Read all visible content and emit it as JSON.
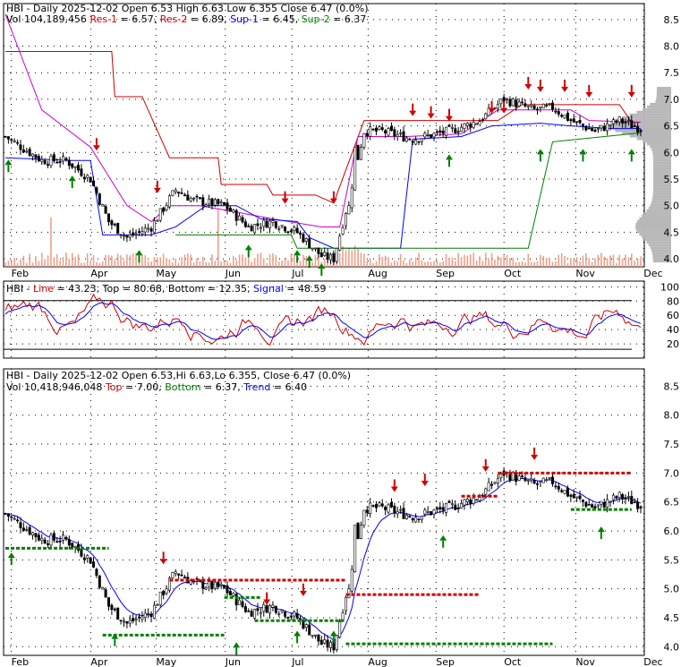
{
  "panels": {
    "top": {
      "info_line1_parts": [
        {
          "text": "HBI - Daily 2025-12-02 Open 6.53  High 6.63  Low 6.355  Close 6.47 (0.0%)",
          "color": "#000000"
        }
      ],
      "info_line2_parts": [
        {
          "text": "Vol 104,189,456 ",
          "color": "#000000"
        },
        {
          "text": "Res-1",
          "color": "#d00000"
        },
        {
          "text": " = 6.57, ",
          "color": "#000000"
        },
        {
          "text": "Res-2",
          "color": "#d00000"
        },
        {
          "text": " = 6.89, ",
          "color": "#000000"
        },
        {
          "text": "Sup-1",
          "color": "#0000ff"
        },
        {
          "text": " = 6.45, ",
          "color": "#000000"
        },
        {
          "text": "Sup-2",
          "color": "#008000"
        },
        {
          "text": " = 6.37",
          "color": "#000000"
        }
      ],
      "y_ticks": [
        "8.5",
        "8.0",
        "7.5",
        "7.0",
        "6.5",
        "6.0",
        "5.5",
        "5.0",
        "4.5",
        "4.0"
      ],
      "y_tick_values": [
        8.5,
        8.0,
        7.5,
        7.0,
        6.5,
        6.0,
        5.5,
        5.0,
        4.5,
        4.0
      ]
    },
    "middle": {
      "info_parts": [
        {
          "text": "HBI - ",
          "color": "#000000"
        },
        {
          "text": "Line",
          "color": "#d00000"
        },
        {
          "text": " = 43.23, Top = 80.68, Bottom = 12.35, ",
          "color": "#000000"
        },
        {
          "text": "Signal",
          "color": "#0000ff"
        },
        {
          "text": " = 48.59",
          "color": "#000000"
        }
      ],
      "y_ticks": [
        "100",
        "80",
        "60",
        "40",
        "20"
      ],
      "y_tick_values": [
        100,
        80,
        60,
        40,
        20
      ]
    },
    "bottom": {
      "info_line1_parts": [
        {
          "text": "HBI - Daily 2025-12-02 Open 6.53,Hi 6.63,Lo 6.355, Close 6.47 (0.0%)",
          "color": "#000000"
        }
      ],
      "info_line2_parts": [
        {
          "text": "Vol 10,418,946,048 ",
          "color": "#000000"
        },
        {
          "text": "Top",
          "color": "#d00000"
        },
        {
          "text": " = 7.00, ",
          "color": "#000000"
        },
        {
          "text": "Bottom",
          "color": "#008000"
        },
        {
          "text": " = 6.37, ",
          "color": "#000000"
        },
        {
          "text": "Trend",
          "color": "#0000ff"
        },
        {
          "text": " = 6.40",
          "color": "#000000"
        }
      ],
      "y_ticks": [
        "8.5",
        "8.0",
        "7.5",
        "7.0",
        "6.5",
        "6.0",
        "5.5",
        "5.0",
        "4.5",
        "4.0"
      ],
      "y_tick_values": [
        8.5,
        8.0,
        7.5,
        7.0,
        6.5,
        6.0,
        5.5,
        5.0,
        4.5,
        4.0
      ]
    }
  },
  "x_month_labels": [
    "Feb",
    "Apr",
    "May",
    "Jun",
    "Jul",
    "Aug",
    "Sep",
    "Oct",
    "Nov",
    "Dec"
  ],
  "x_month_positions": [
    0.012,
    0.136,
    0.238,
    0.346,
    0.45,
    0.569,
    0.675,
    0.781,
    0.893,
    0.999
  ],
  "colors": {
    "up": "#008000",
    "down": "#d00000",
    "resistance": "#d00000",
    "support": "#008000",
    "trend": "#0000ff",
    "magenta": "#cc00cc",
    "volume": "#f0a08a",
    "profile": "#b8b8b8"
  },
  "chart_data": [
    {
      "type": "candlestick",
      "title": "HBI - Daily 2025-12-02 Open 6.53  High 6.63  Low 6.355  Close 6.47 (0.0%)",
      "ylim": [
        3.85,
        8.8
      ],
      "x": [
        "2025-02",
        "2025-03",
        "2025-04",
        "2025-05",
        "2025-06",
        "2025-07",
        "2025-08",
        "2025-09",
        "2025-10",
        "2025-11",
        "2025-12"
      ],
      "key_points": [
        [
          0,
          6.3
        ],
        [
          12,
          5.85
        ],
        [
          20,
          5.85
        ],
        [
          28,
          5.5
        ],
        [
          34,
          4.7
        ],
        [
          40,
          4.4
        ],
        [
          48,
          4.6
        ],
        [
          56,
          5.3
        ],
        [
          62,
          5.1
        ],
        [
          72,
          5.0
        ],
        [
          80,
          4.6
        ],
        [
          88,
          4.7
        ],
        [
          96,
          4.5
        ],
        [
          104,
          4.05
        ],
        [
          108,
          4.0
        ],
        [
          112,
          4.9
        ],
        [
          118,
          6.4
        ],
        [
          124,
          6.4
        ],
        [
          134,
          6.25
        ],
        [
          146,
          6.4
        ],
        [
          156,
          6.6
        ],
        [
          164,
          7.0
        ],
        [
          174,
          6.8
        ],
        [
          180,
          6.85
        ],
        [
          186,
          6.6
        ],
        [
          194,
          6.4
        ],
        [
          202,
          6.6
        ],
        [
          209,
          6.45
        ]
      ],
      "resistance_1": 6.57,
      "resistance_2": 6.89,
      "support_1": 6.45,
      "support_2": 6.37,
      "volume_label": "Vol 104,189,456"
    },
    {
      "type": "line",
      "title": "HBI - Line = 43.23, Top = 80.68, Bottom = 12.35, Signal = 48.59",
      "ylim": [
        0,
        100
      ],
      "series": [
        {
          "name": "Line",
          "last": 43.23
        },
        {
          "name": "Signal",
          "last": 48.59
        }
      ],
      "top": 80.68,
      "bottom": 12.35
    },
    {
      "type": "candlestick",
      "title": "HBI - Daily 2025-12-02 Open 6.53,Hi 6.63,Lo 6.355, Close 6.47 (0.0%)",
      "ylim": [
        3.85,
        8.8
      ],
      "top": 7.0,
      "bottom": 6.37,
      "trend": 6.4,
      "volume_label": "Vol 10,418,946,048"
    }
  ]
}
